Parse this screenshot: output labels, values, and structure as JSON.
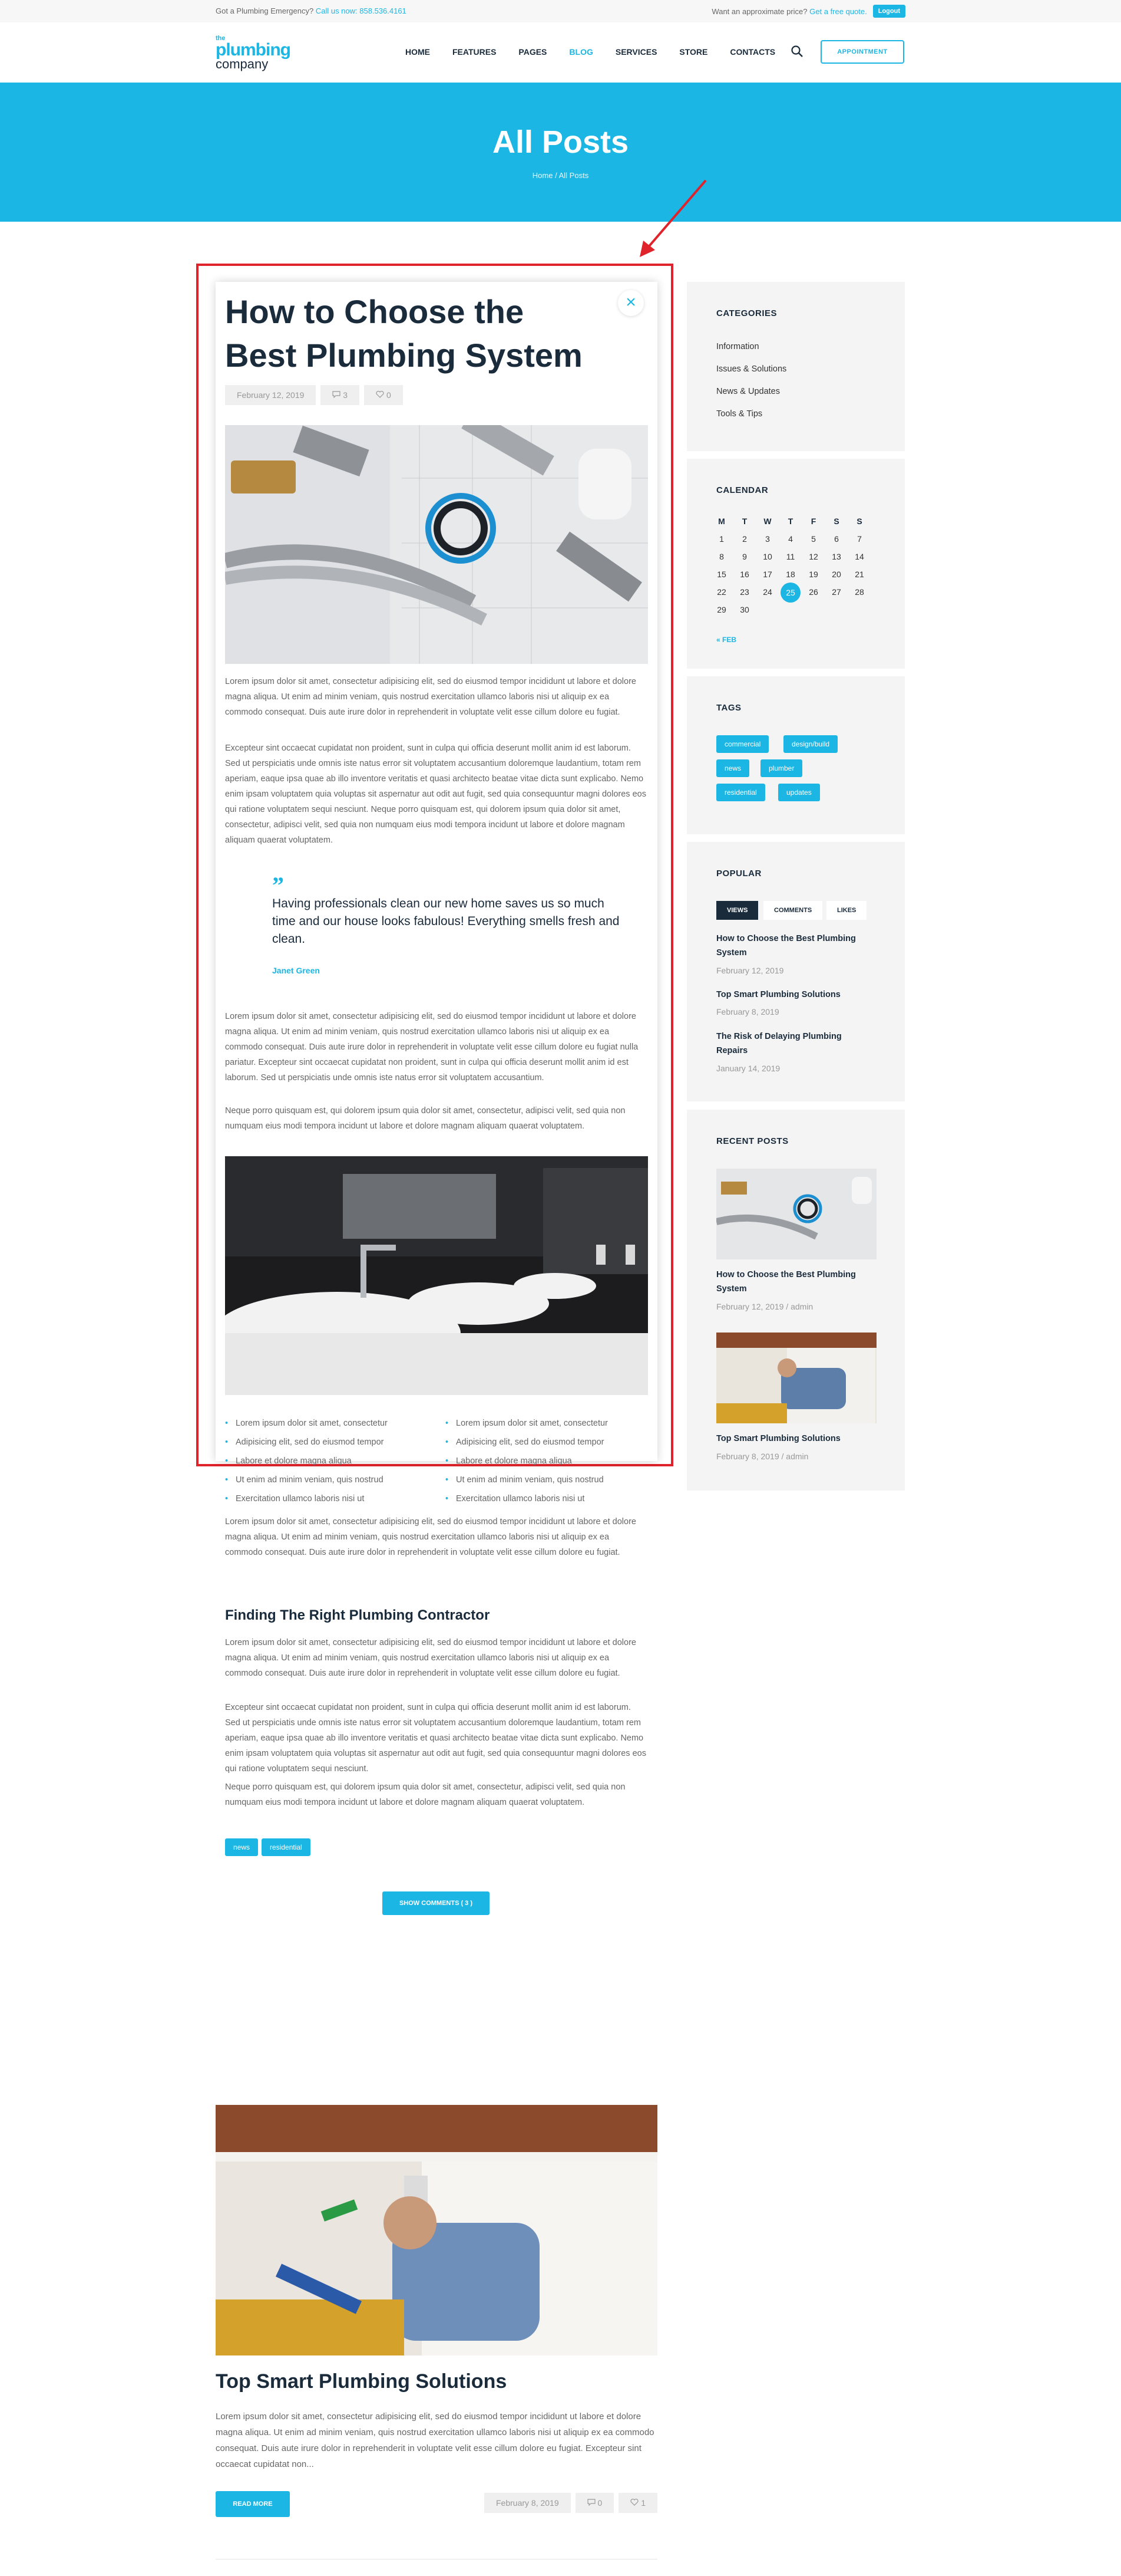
{
  "topbar": {
    "emergency": "Got a Plumbing Emergency?",
    "call_label": "Call us now:",
    "phone": "858.536.4161",
    "price_question": "Want an approximate price?",
    "quote_link": "Get a free quote.",
    "logout": "Logout"
  },
  "logo": {
    "the": "the",
    "word1": "plumbing",
    "word2": "company"
  },
  "nav": [
    "HOME",
    "FEATURES",
    "PAGES",
    "BLOG",
    "SERVICES",
    "STORE",
    "CONTACTS"
  ],
  "nav_active": "BLOG",
  "appointment": "APPOINTMENT",
  "hero": {
    "title": "All Posts",
    "crumb_home": "Home",
    "crumb_sep": "/",
    "crumb_current": "All Posts"
  },
  "post": {
    "title": "How to Choose the Best Plumbing System",
    "date": "February 12, 2019",
    "comments": "3",
    "likes": "0",
    "close": "×",
    "p1": "Lorem ipsum dolor sit amet, consectetur adipisicing elit, sed do eiusmod tempor incididunt ut labore et dolore magna aliqua. Ut enim ad minim veniam, quis nostrud exercitation ullamco laboris nisi ut aliquip ex ea commodo consequat. Duis aute irure dolor in reprehenderit in voluptate velit esse cillum dolore eu fugiat.",
    "p2": "Excepteur sint occaecat cupidatat non proident, sunt in culpa qui officia deserunt mollit anim id est laborum. Sed ut perspiciatis unde omnis iste natus error sit voluptatem accusantium doloremque laudantium, totam rem aperiam, eaque ipsa quae ab illo inventore veritatis et quasi architecto beatae vitae dicta sunt explicabo. Nemo enim ipsam voluptatem quia voluptas sit aspernatur aut odit aut fugit, sed quia consequuntur magni dolores eos qui ratione voluptatem sequi nesciunt. Neque porro quisquam est, qui dolorem ipsum quia dolor sit amet, consectetur, adipisci velit, sed quia non numquam eius modi tempora incidunt ut labore et dolore magnam aliquam quaerat voluptatem.",
    "quote_mark": "”",
    "quote": "Having professionals clean our new home saves us so much time and our house looks fabulous! Everything smells fresh and clean.",
    "quote_author": "Janet Green",
    "p3": "Lorem ipsum dolor sit amet, consectetur adipisicing elit, sed do eiusmod tempor incididunt ut labore et dolore magna aliqua. Ut enim ad minim veniam, quis nostrud exercitation ullamco laboris nisi ut aliquip ex ea commodo consequat. Duis aute irure dolor in reprehenderit in voluptate velit esse cillum dolore eu fugiat nulla pariatur. Excepteur sint occaecat cupidatat non proident, sunt in culpa qui officia deserunt mollit anim id est laborum. Sed ut perspiciatis unde omnis iste natus error sit voluptatem accusantium.",
    "p4": "Neque porro quisquam est, qui dolorem ipsum quia dolor sit amet, consectetur, adipisci velit, sed quia non numquam eius modi tempora incidunt ut labore et dolore magnam aliquam quaerat voluptatem.",
    "list_left": [
      "Lorem ipsum dolor sit amet, consectetur",
      "Adipisicing elit, sed do eiusmod tempor",
      "Labore et dolore magna aliqua",
      "Ut enim ad minim veniam, quis nostrud",
      "Exercitation ullamco laboris nisi ut"
    ],
    "list_right": [
      "Lorem ipsum dolor sit amet, consectetur",
      "Adipisicing elit, sed do eiusmod tempor",
      "Labore et dolore magna aliqua",
      "Ut enim ad minim veniam, quis nostrud",
      "Exercitation ullamco laboris nisi ut"
    ],
    "p5": "Lorem ipsum dolor sit amet, consectetur adipisicing elit, sed do eiusmod tempor incididunt ut labore et dolore magna aliqua. Ut enim ad minim veniam, quis nostrud exercitation ullamco laboris nisi ut aliquip ex ea commodo consequat. Duis aute irure dolor in reprehenderit in voluptate velit esse cillum dolore eu fugiat.",
    "subheading": "Finding The Right Plumbing Contractor",
    "p6": "Lorem ipsum dolor sit amet, consectetur adipisicing elit, sed do eiusmod tempor incididunt ut labore et dolore magna aliqua. Ut enim ad minim veniam, quis nostrud exercitation ullamco laboris nisi ut aliquip ex ea commodo consequat. Duis aute irure dolor in reprehenderit in voluptate velit esse cillum dolore eu fugiat.",
    "p7": "Excepteur sint occaecat cupidatat non proident, sunt in culpa qui officia deserunt mollit anim id est laborum. Sed ut perspiciatis unde omnis iste natus error sit voluptatem accusantium doloremque laudantium, totam rem aperiam, eaque ipsa quae ab illo inventore veritatis et quasi architecto beatae vitae dicta sunt explicabo. Nemo enim ipsam voluptatem quia voluptas sit aspernatur aut odit aut fugit, sed quia consequuntur magni dolores eos qui ratione voluptatem sequi nesciunt.",
    "p8": "Neque porro quisquam est, qui dolorem ipsum quia dolor sit amet, consectetur, adipisci velit, sed quia non numquam eius modi tempora incidunt ut labore et dolore magnam aliquam quaerat voluptatem.",
    "tags": [
      "news",
      "residential"
    ],
    "show_comments": "SHOW COMMENTS ( 3 )"
  },
  "sidebar": {
    "categories": {
      "title": "CATEGORIES",
      "items": [
        "Information",
        "Issues & Solutions",
        "News & Updates",
        "Tools & Tips"
      ]
    },
    "calendar": {
      "title": "CALENDAR",
      "days": [
        "M",
        "T",
        "W",
        "T",
        "F",
        "S",
        "S"
      ],
      "rows": [
        [
          "1",
          "2",
          "3",
          "4",
          "5",
          "6",
          "7"
        ],
        [
          "8",
          "9",
          "10",
          "11",
          "12",
          "13",
          "14"
        ],
        [
          "15",
          "16",
          "17",
          "18",
          "19",
          "20",
          "21"
        ],
        [
          "22",
          "23",
          "24",
          "25",
          "26",
          "27",
          "28"
        ],
        [
          "29",
          "30",
          "",
          "",
          "",
          "",
          ""
        ]
      ],
      "today": "25",
      "prev": "« FEB"
    },
    "tags": {
      "title": "TAGS",
      "items": [
        "commercial",
        "design/build",
        "news",
        "plumber",
        "residential",
        "updates"
      ]
    },
    "popular": {
      "title": "POPULAR",
      "tabs": [
        "VIEWS",
        "COMMENTS",
        "LIKES"
      ],
      "items": [
        {
          "title": "How to Choose the Best Plumbing System",
          "date": "February 12, 2019"
        },
        {
          "title": "Top Smart Plumbing Solutions",
          "date": "February 8, 2019"
        },
        {
          "title": "The Risk of Delaying Plumbing Repairs",
          "date": "January 14, 2019"
        }
      ]
    },
    "recent": {
      "title": "RECENT POSTS",
      "items": [
        {
          "title": "How to Choose the Best Plumbing System",
          "date": "February 12, 2019",
          "sep": " / ",
          "author": "admin"
        },
        {
          "title": "Top Smart Plumbing Solutions",
          "date": "February 8, 2019",
          "sep": " / ",
          "author": "admin"
        }
      ]
    }
  },
  "post2": {
    "title": "Top Smart Plumbing Solutions",
    "excerpt": "Lorem ipsum dolor sit amet, consectetur adipisicing elit, sed do eiusmod tempor incididunt ut labore et dolore magna aliqua. Ut enim ad minim veniam, quis nostrud exercitation ullamco laboris nisi ut aliquip ex ea commodo consequat. Duis aute irure dolor in reprehenderit in voluptate velit esse cillum dolore eu fugiat. Excepteur sint occaecat cupidatat non...",
    "read_more": "READ MORE",
    "date": "February 8, 2019",
    "comments": "0",
    "likes": "1"
  },
  "colors": {
    "accent": "#1cb6e4",
    "dark": "#1a2b3c",
    "highlight": "#e0222a"
  },
  "icons": [
    "search-icon",
    "close-icon",
    "comment-icon",
    "heart-icon",
    "quote-icon",
    "arrow-annotation"
  ]
}
